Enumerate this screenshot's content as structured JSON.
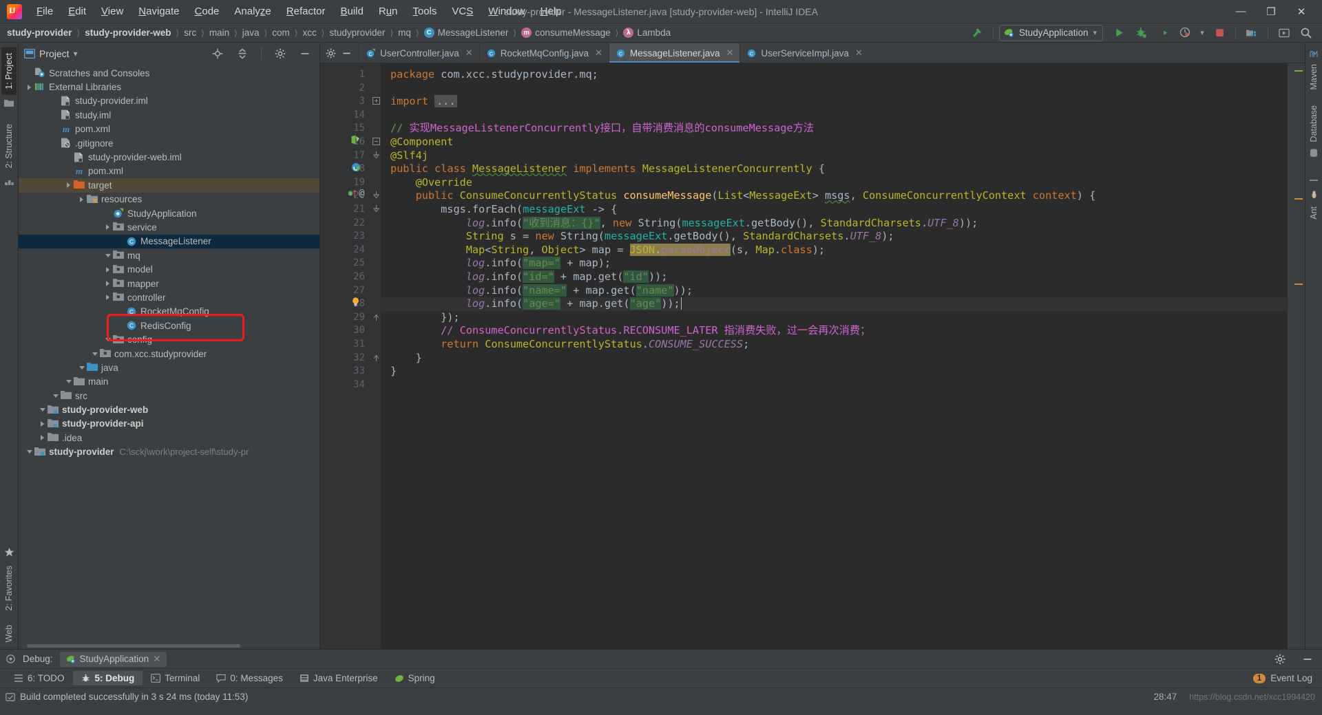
{
  "window": {
    "title": "study-provider - MessageListener.java [study-provider-web] - IntelliJ IDEA",
    "minimize_label": "—",
    "maximize_label": "❐",
    "close_label": "✕"
  },
  "menubar": {
    "items": [
      {
        "label": "File",
        "mnemonic": "F"
      },
      {
        "label": "Edit",
        "mnemonic": "E"
      },
      {
        "label": "View",
        "mnemonic": "V"
      },
      {
        "label": "Navigate",
        "mnemonic": "N"
      },
      {
        "label": "Code",
        "mnemonic": "C"
      },
      {
        "label": "Analyze",
        "mnemonic": "z"
      },
      {
        "label": "Refactor",
        "mnemonic": "R"
      },
      {
        "label": "Build",
        "mnemonic": "B"
      },
      {
        "label": "Run",
        "mnemonic": "u"
      },
      {
        "label": "Tools",
        "mnemonic": "T"
      },
      {
        "label": "VCS",
        "mnemonic": "S"
      },
      {
        "label": "Window",
        "mnemonic": "W"
      },
      {
        "label": "Help",
        "mnemonic": "H"
      }
    ]
  },
  "breadcrumb": {
    "items": [
      {
        "label": "study-provider",
        "bold": true,
        "icon": null
      },
      {
        "label": "study-provider-web",
        "bold": true,
        "icon": null
      },
      {
        "label": "src",
        "bold": false,
        "icon": null
      },
      {
        "label": "main",
        "bold": false,
        "icon": null
      },
      {
        "label": "java",
        "bold": false,
        "icon": null
      },
      {
        "label": "com",
        "bold": false,
        "icon": null
      },
      {
        "label": "xcc",
        "bold": false,
        "icon": null
      },
      {
        "label": "studyprovider",
        "bold": false,
        "icon": null
      },
      {
        "label": "mq",
        "bold": false,
        "icon": null
      },
      {
        "label": "MessageListener",
        "bold": false,
        "icon": "class-icon",
        "icon_letter": "C"
      },
      {
        "label": "consumeMessage",
        "bold": false,
        "icon": "method-icon",
        "icon_letter": "m"
      },
      {
        "label": "Lambda",
        "bold": false,
        "icon": "lambda-icon",
        "icon_letter": "λ"
      }
    ]
  },
  "toolbar": {
    "run_configuration": "StudyApplication",
    "dropdown_caret": "▾",
    "buttons": [
      {
        "name": "build-hammer-icon",
        "tooltip": "Build Project"
      },
      {
        "name": "run-icon",
        "tooltip": "Run"
      },
      {
        "name": "debug-icon",
        "tooltip": "Debug"
      },
      {
        "name": "run-coverage-icon",
        "tooltip": "Run with Coverage"
      },
      {
        "name": "profiler-icon",
        "tooltip": "Profiler"
      },
      {
        "name": "stop-icon",
        "tooltip": "Stop"
      },
      {
        "name": "project-structure-icon",
        "tooltip": "Project Structure"
      },
      {
        "name": "update-app-icon",
        "tooltip": "Update Application"
      },
      {
        "name": "search-everywhere-icon",
        "tooltip": "Search Everywhere"
      }
    ],
    "accent_green": "#499c54",
    "accent_red": "#c75450",
    "accent_blue": "#3b93c4"
  },
  "left_rail": {
    "tabs": [
      {
        "label": "1: Project",
        "active": true,
        "name": "sidebar-tab-project"
      },
      {
        "label": "2: Structure",
        "active": false,
        "name": "sidebar-tab-structure"
      }
    ],
    "bottom_tabs": [
      {
        "label": "2: Favorites",
        "name": "sidebar-tab-favorites"
      },
      {
        "label": "Web",
        "name": "sidebar-tab-web"
      }
    ]
  },
  "right_rail": {
    "tabs": [
      {
        "label": "Maven",
        "name": "sidebar-tab-maven"
      },
      {
        "label": "Database",
        "name": "sidebar-tab-database"
      },
      {
        "label": "Ant",
        "name": "sidebar-tab-ant"
      }
    ]
  },
  "project_panel": {
    "title": "Project",
    "caret": "▾",
    "header_buttons": [
      {
        "name": "locate-icon"
      },
      {
        "name": "collapse-all-icon"
      },
      {
        "name": "gear-icon"
      },
      {
        "name": "hide-icon"
      }
    ],
    "tree": [
      {
        "depth": 0,
        "label": "study-provider",
        "path": "C:\\sckj\\work\\project-self\\study-pr",
        "icon": "module-folder-icon",
        "expanded": true,
        "bold": true
      },
      {
        "depth": 1,
        "label": ".idea",
        "icon": "folder-icon",
        "expanded": false,
        "bold": false
      },
      {
        "depth": 1,
        "label": "study-provider-api",
        "icon": "module-folder-icon",
        "expanded": false,
        "bold": true
      },
      {
        "depth": 1,
        "label": "study-provider-web",
        "icon": "module-folder-icon",
        "expanded": true,
        "bold": true
      },
      {
        "depth": 2,
        "label": "src",
        "icon": "folder-icon",
        "expanded": true,
        "bold": false
      },
      {
        "depth": 3,
        "label": "main",
        "icon": "folder-icon",
        "expanded": true,
        "bold": false
      },
      {
        "depth": 4,
        "label": "java",
        "icon": "source-folder-icon",
        "expanded": true,
        "bold": false
      },
      {
        "depth": 5,
        "label": "com.xcc.studyprovider",
        "icon": "package-icon",
        "expanded": true,
        "bold": false
      },
      {
        "depth": 6,
        "label": "config",
        "icon": "package-icon",
        "expanded": true,
        "bold": false
      },
      {
        "depth": 7,
        "label": "RedisConfig",
        "icon": "class-icon",
        "expanded": null,
        "bold": false
      },
      {
        "depth": 7,
        "label": "RocketMqConfig",
        "icon": "class-icon",
        "expanded": null,
        "bold": false
      },
      {
        "depth": 6,
        "label": "controller",
        "icon": "package-icon",
        "expanded": false,
        "bold": false
      },
      {
        "depth": 6,
        "label": "mapper",
        "icon": "package-icon",
        "expanded": false,
        "bold": false
      },
      {
        "depth": 6,
        "label": "model",
        "icon": "package-icon",
        "expanded": false,
        "bold": false
      },
      {
        "depth": 6,
        "label": "mq",
        "icon": "package-icon",
        "expanded": true,
        "bold": false
      },
      {
        "depth": 7,
        "label": "MessageListener",
        "icon": "class-icon",
        "expanded": null,
        "bold": false,
        "selected": true
      },
      {
        "depth": 6,
        "label": "service",
        "icon": "package-icon",
        "expanded": false,
        "bold": false
      },
      {
        "depth": 6,
        "label": "StudyApplication",
        "icon": "spring-class-icon",
        "expanded": null,
        "bold": false
      },
      {
        "depth": 4,
        "label": "resources",
        "icon": "resources-folder-icon",
        "expanded": false,
        "bold": false
      },
      {
        "depth": 3,
        "label": "target",
        "icon": "excluded-folder-icon",
        "expanded": false,
        "bold": false,
        "highlighted": true
      },
      {
        "depth": 3,
        "label": "pom.xml",
        "icon": "maven-icon",
        "expanded": null,
        "bold": false
      },
      {
        "depth": 3,
        "label": "study-provider-web.iml",
        "icon": "iml-icon",
        "expanded": null,
        "bold": false
      },
      {
        "depth": 2,
        "label": ".gitignore",
        "icon": "gitignore-icon",
        "expanded": null,
        "bold": false
      },
      {
        "depth": 2,
        "label": "pom.xml",
        "icon": "maven-icon",
        "expanded": null,
        "bold": false
      },
      {
        "depth": 2,
        "label": "study.iml",
        "icon": "iml-icon",
        "expanded": null,
        "bold": false
      },
      {
        "depth": 2,
        "label": "study-provider.iml",
        "icon": "iml-icon",
        "expanded": null,
        "bold": false
      },
      {
        "depth": 0,
        "label": "External Libraries",
        "icon": "libraries-icon",
        "expanded": false,
        "bold": false
      },
      {
        "depth": 0,
        "label": "Scratches and Consoles",
        "icon": "scratches-icon",
        "expanded": null,
        "bold": false
      }
    ]
  },
  "editor": {
    "tabs": [
      {
        "label": "UserController.java",
        "icon": "spring-class-icon",
        "active": false,
        "close": "✕"
      },
      {
        "label": "RocketMqConfig.java",
        "icon": "class-icon",
        "active": false,
        "close": "✕"
      },
      {
        "label": "MessageListener.java",
        "icon": "class-icon",
        "active": true,
        "close": "✕"
      },
      {
        "label": "UserServiceImpl.java",
        "icon": "class-icon",
        "active": false,
        "close": "✕"
      }
    ],
    "line_numbers": [
      1,
      2,
      3,
      14,
      15,
      16,
      17,
      18,
      19,
      20,
      21,
      22,
      23,
      24,
      25,
      26,
      27,
      28,
      29,
      30,
      31,
      32,
      33,
      34
    ],
    "current_line": 28,
    "caret_position": "28:47",
    "code_lines": [
      "package com.xcc.studyprovider.mq;",
      "",
      "import ...",
      "",
      "// 实现MessageListenerConcurrently接口，自带消费消息的consumeMessage方法",
      "@Component",
      "@Slf4j",
      "public class MessageListener implements MessageListenerConcurrently {",
      "    @Override",
      "    public ConsumeConcurrentlyStatus consumeMessage(List<MessageExt> msgs, ConsumeConcurrentlyContext context) {",
      "        msgs.forEach(messageExt -> {",
      "            log.info(\"收到消息：{}\", new String(messageExt.getBody(), StandardCharsets.UTF_8));",
      "            String s = new String(messageExt.getBody(), StandardCharsets.UTF_8);",
      "            Map<String, Object> map = JSON.parseObject(s, Map.class);",
      "            log.info(\"map=\" + map);",
      "            log.info(\"id=\" + map.get(\"id\"));",
      "            log.info(\"name=\" + map.get(\"name\"));",
      "            log.info(\"age=\" + map.get(\"age\"));",
      "        });",
      "        // ConsumeConcurrentlyStatus.RECONSUME_LATER 指消费失败，过一会再次消费；",
      "        return ConsumeConcurrentlyStatus.CONSUME_SUCCESS;",
      "    }",
      "}",
      ""
    ]
  },
  "debug_panel": {
    "label": "Debug:",
    "session": "StudyApplication",
    "close": "✕",
    "settings_icon": "gear-icon",
    "hide_icon": "hide-icon"
  },
  "tool_buttons": [
    {
      "label": "6: TODO",
      "icon": "todo-icon",
      "active": false
    },
    {
      "label": "5: Debug",
      "icon": "debug-icon",
      "active": true
    },
    {
      "label": "Terminal",
      "icon": "terminal-icon",
      "active": false
    },
    {
      "label": "0: Messages",
      "icon": "messages-icon",
      "active": false
    },
    {
      "label": "Java Enterprise",
      "icon": "java-enterprise-icon",
      "active": false
    },
    {
      "label": "Spring",
      "icon": "spring-icon",
      "active": false
    }
  ],
  "event_log": {
    "count": "1",
    "label": "Event Log"
  },
  "status_bar": {
    "message": "Build completed successfully in 3 s 24 ms (today 11:53)",
    "caret": "28:47",
    "watermark": "https://blog.csdn.net/xcc1994420"
  }
}
